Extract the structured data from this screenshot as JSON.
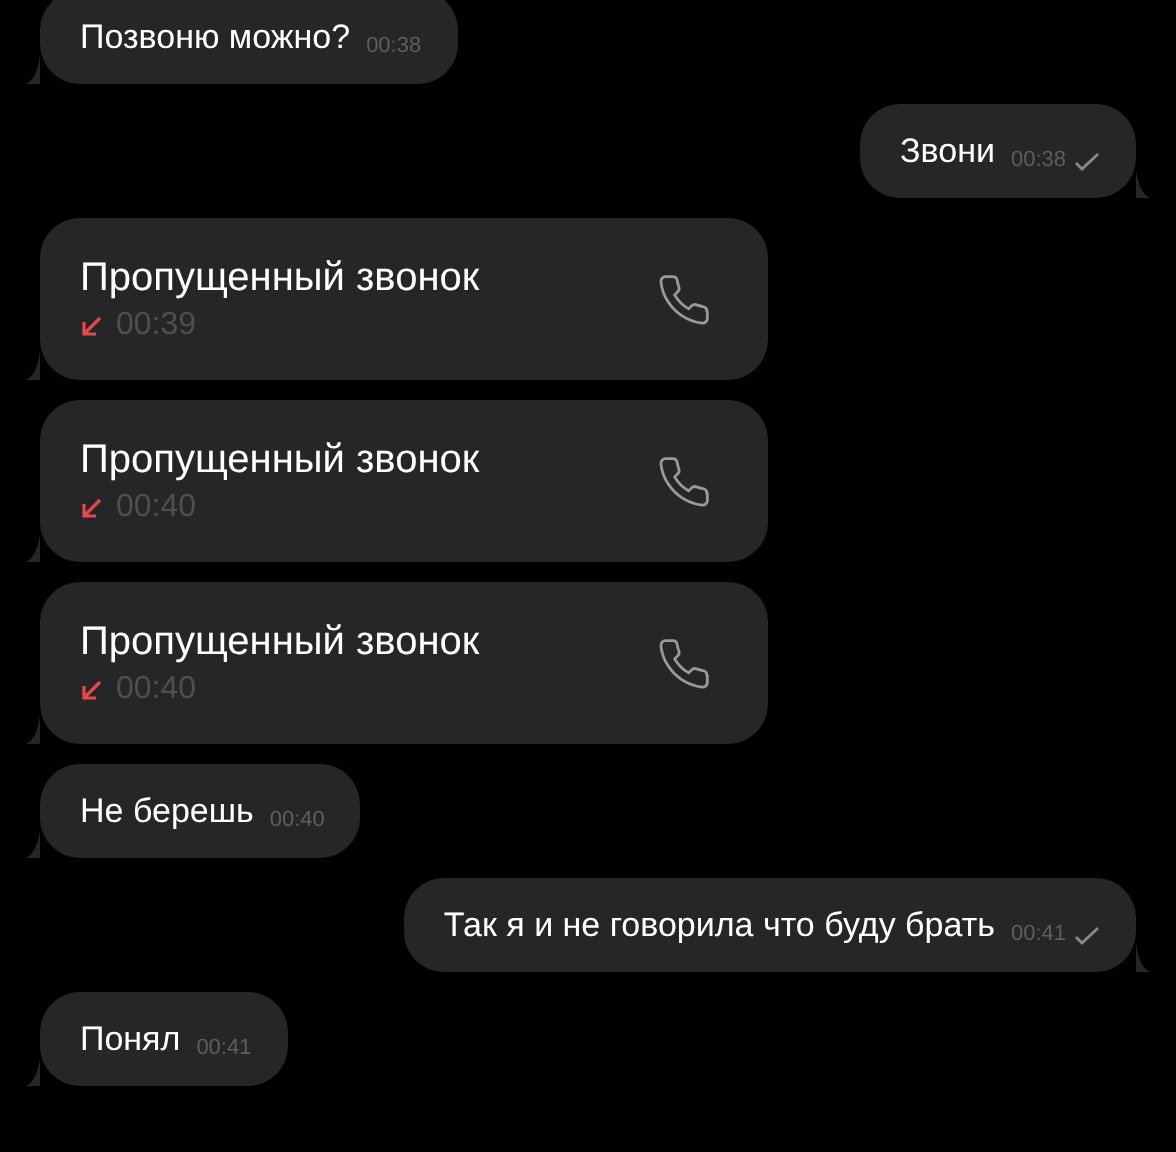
{
  "messages": [
    {
      "kind": "text",
      "outgoing": false,
      "text": "Позвоню можно?",
      "time": "00:38"
    },
    {
      "kind": "text",
      "outgoing": true,
      "text": "Звони",
      "time": "00:38"
    },
    {
      "kind": "missed_call",
      "outgoing": false,
      "text": "Пропущенный звонок",
      "time": "00:39"
    },
    {
      "kind": "missed_call",
      "outgoing": false,
      "text": "Пропущенный звонок",
      "time": "00:40"
    },
    {
      "kind": "missed_call",
      "outgoing": false,
      "text": "Пропущенный звонок",
      "time": "00:40"
    },
    {
      "kind": "text",
      "outgoing": false,
      "text": "Не берешь",
      "time": "00:40"
    },
    {
      "kind": "text",
      "outgoing": true,
      "text": "Так я и не говорила что буду брать",
      "time": "00:41"
    },
    {
      "kind": "text",
      "outgoing": false,
      "text": "Понял",
      "time": "00:41"
    }
  ]
}
